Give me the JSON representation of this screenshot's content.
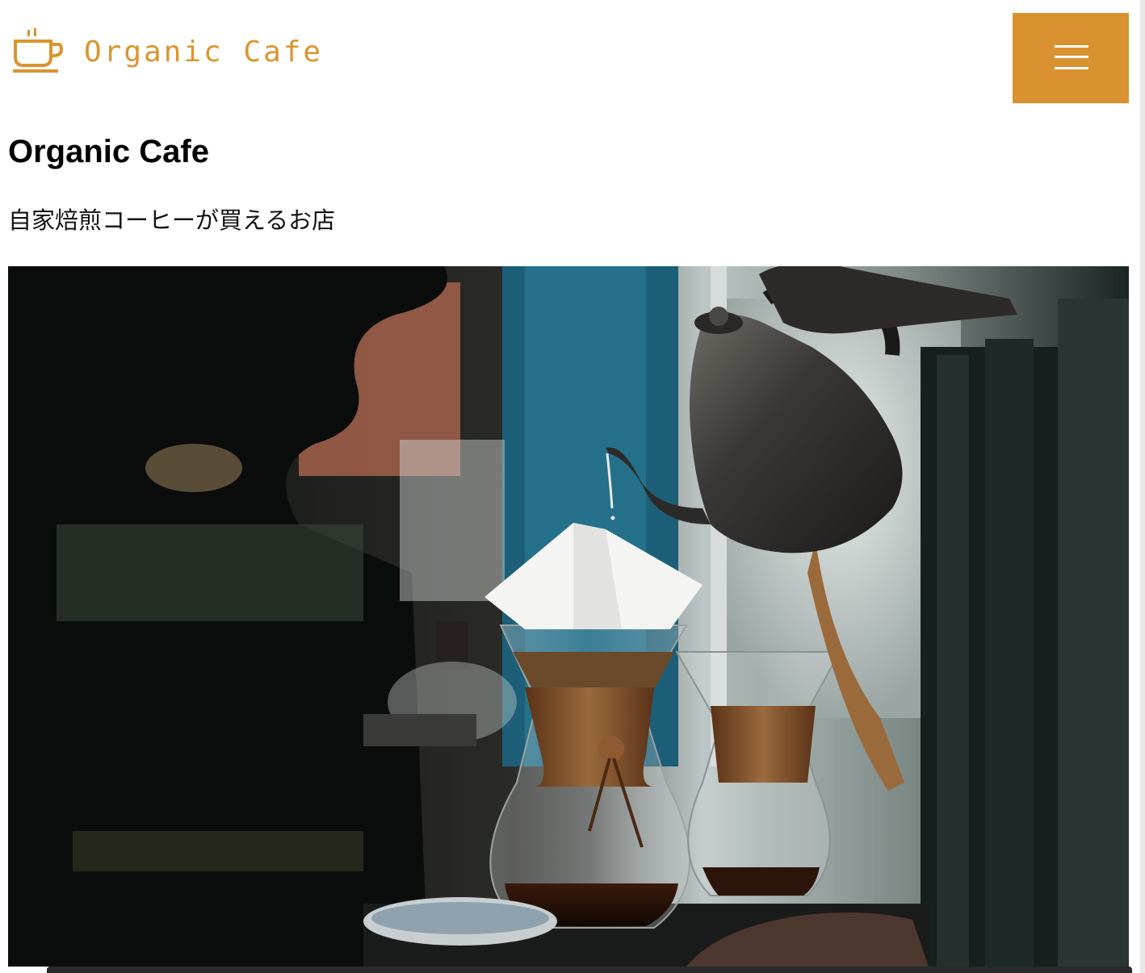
{
  "header": {
    "logo_text": "Organic Cafe",
    "logo_icon": "coffee-cup-icon",
    "menu_icon": "hamburger-icon",
    "accent_color": "#d9922f"
  },
  "hero": {
    "title": "Organic Cafe",
    "tagline": "自家焙煎コーヒーが買えるお店"
  }
}
